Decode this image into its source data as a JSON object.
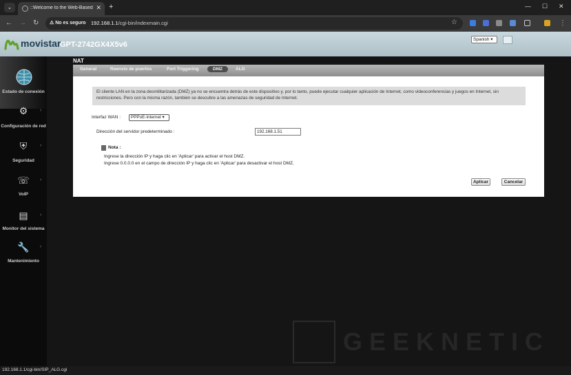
{
  "browser": {
    "tab_title": "::Welcome to the Web-Based C",
    "security_label": "No es seguro",
    "url_host": "192.168.1.1",
    "url_path": "/cgi-bin/indexmain.cgi",
    "status_url": "192.168.1.1/cgi-bin/SIP_ALG.cgi"
  },
  "header": {
    "brand": "movistar",
    "model": "GPT-2742GX4X5v6",
    "language": "Spanish"
  },
  "section_title": "NAT",
  "subtabs": [
    "General",
    "Reenvío de puertos",
    "Port Triggering",
    "DMZ",
    "ALG"
  ],
  "dmz": {
    "info": "El cliente LAN en la zona desmilitarizada (DMZ) ya no se encuentra detrás de este dispositivo y, por lo tanto, puede ejecutar cualquier aplicación de Internet, como videoconferencias y juegos en Internet, sin restricciones. Pero con la misma razón, también se descubre a las amenazas de seguridad de Internet.",
    "wan_label": "Interfaz WAN :",
    "wan_value": "PPPoE-Internet",
    "server_label": "Dirección del servidor predeterminado :",
    "server_value": "192.168.1.51",
    "note_title": "Nota :",
    "note_line1": "Ingrese la dirección IP y haga clic en 'Aplicar' para activar el host DMZ.",
    "note_line2": "Ingrese 0.0.0.0 en el campo de dirección IP y haga clic en 'Aplicar' para desactivar el host DMZ.",
    "apply": "Aplicar",
    "cancel": "Cancelar"
  },
  "sidebar": [
    {
      "label": "Estado de conexión",
      "icon": "globe-icon"
    },
    {
      "label": "Configuración de red",
      "icon": "gears-icon"
    },
    {
      "label": "Seguridad",
      "icon": "shield-icon"
    },
    {
      "label": "VoIP",
      "icon": "phone-icon"
    },
    {
      "label": "Monitor del sistema",
      "icon": "monitor-icon"
    },
    {
      "label": "Mantenimiento",
      "icon": "wrench-icon"
    }
  ],
  "watermark": "GEEKNETIC"
}
